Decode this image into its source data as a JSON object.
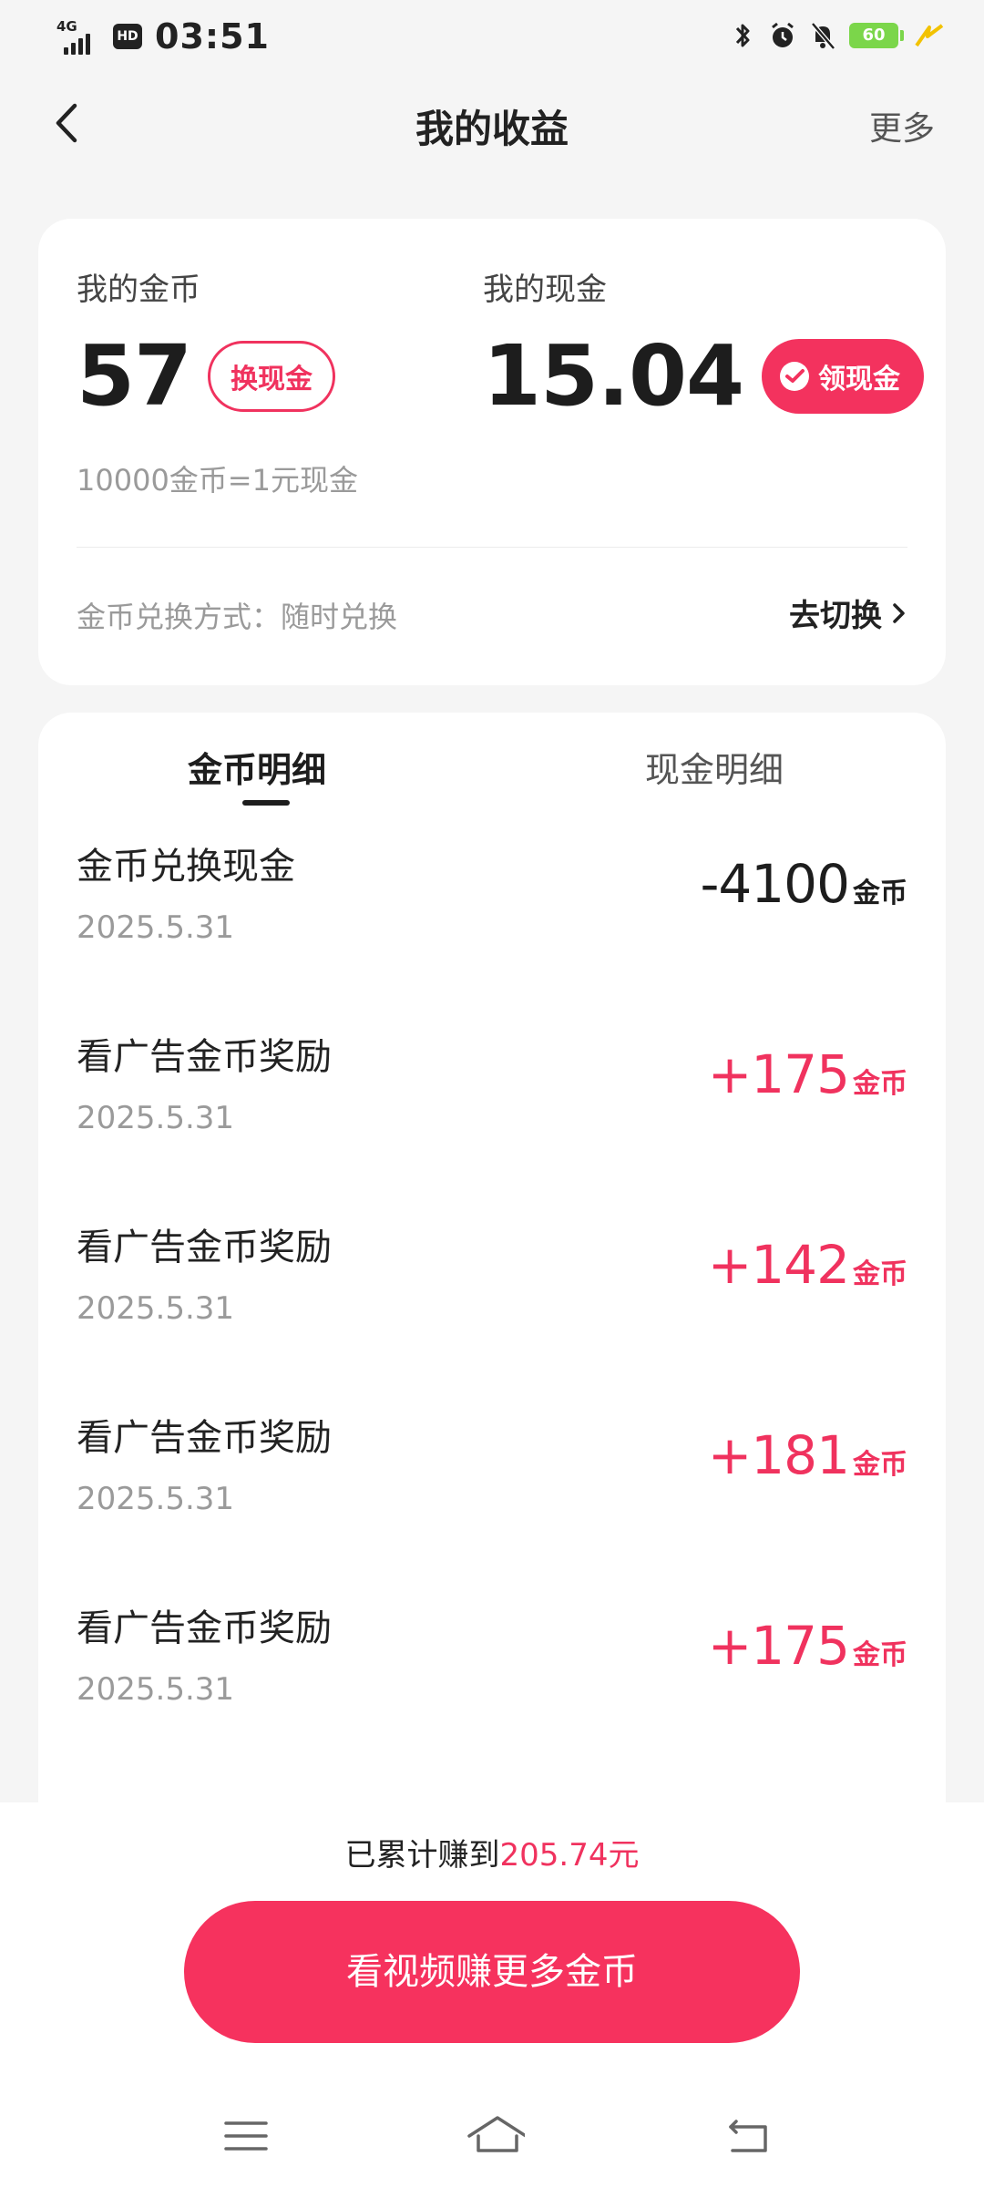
{
  "status_bar": {
    "network": "4G",
    "hd": "HD",
    "time": "03:51",
    "battery": "60",
    "icons": [
      "bluetooth-icon",
      "alarm-icon",
      "mute-bell-icon",
      "battery-icon",
      "charging-icon"
    ]
  },
  "header": {
    "title": "我的收益",
    "more": "更多"
  },
  "summary": {
    "coins_label": "我的金币",
    "coins_value": "57",
    "exchange_button": "换现金",
    "cash_label": "我的现金",
    "cash_value": "15.04",
    "claim_button": "领现金",
    "rate_text": "10000金币=1元现金",
    "method_text": "金币兑换方式：随时兑换",
    "switch_link": "去切换"
  },
  "tabs": {
    "coin_detail": "金币明细",
    "cash_detail": "现金明细",
    "active": "coin_detail"
  },
  "records": [
    {
      "title": "金币兑换现金",
      "date": "2025.5.31",
      "amount": "-4100",
      "unit": "金币",
      "kind": "neg"
    },
    {
      "title": "看广告金币奖励",
      "date": "2025.5.31",
      "amount": "+175",
      "unit": "金币",
      "kind": "pos"
    },
    {
      "title": "看广告金币奖励",
      "date": "2025.5.31",
      "amount": "+142",
      "unit": "金币",
      "kind": "pos"
    },
    {
      "title": "看广告金币奖励",
      "date": "2025.5.31",
      "amount": "+181",
      "unit": "金币",
      "kind": "pos"
    },
    {
      "title": "看广告金币奖励",
      "date": "2025.5.31",
      "amount": "+175",
      "unit": "金币",
      "kind": "pos"
    }
  ],
  "footer": {
    "earned_prefix": "已累计赚到",
    "earned_amount": "205.74元",
    "cta_button": "看视频赚更多金币"
  },
  "colors": {
    "accent": "#f3325e",
    "text_primary": "#1d1d1d",
    "text_secondary": "#9a9a9a",
    "background": "#f5f5f5",
    "card": "#ffffff"
  }
}
